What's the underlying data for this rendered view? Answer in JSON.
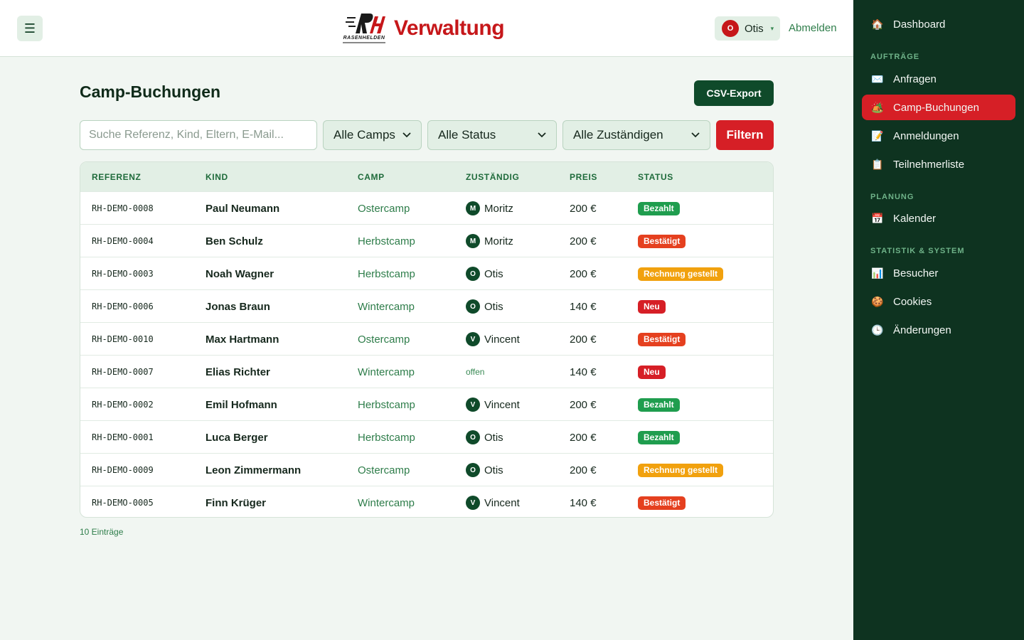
{
  "header": {
    "menu_icon": "☰",
    "logo_letters": "RH",
    "logo_text": "RASENHELDEN",
    "title": "Verwaltung",
    "user_initial": "O",
    "user_name": "Otis",
    "caret": "▾",
    "logout": "Abmelden"
  },
  "main": {
    "title": "Camp-Buchungen",
    "csv_button": "CSV-Export",
    "search_placeholder": "Suche Referenz, Kind, Eltern, E-Mail...",
    "filter_camp": "Alle Camps",
    "filter_status": "Alle Status",
    "filter_owner": "Alle Zuständigen",
    "filter_button": "Filtern",
    "count": "10 Einträge"
  },
  "table": {
    "headers": [
      "REFERENZ",
      "KIND",
      "CAMP",
      "ZUSTÄNDIG",
      "PREIS",
      "STATUS"
    ],
    "rows": [
      {
        "ref": "RH-DEMO-0008",
        "kind": "Paul Neumann",
        "camp": "Ostercamp",
        "initial": "M",
        "owner": "Moritz",
        "price": "200 €",
        "status": "Bezahlt",
        "status_type": "paid"
      },
      {
        "ref": "RH-DEMO-0004",
        "kind": "Ben Schulz",
        "camp": "Herbstcamp",
        "initial": "M",
        "owner": "Moritz",
        "price": "200 €",
        "status": "Bestätigt",
        "status_type": "conf"
      },
      {
        "ref": "RH-DEMO-0003",
        "kind": "Noah Wagner",
        "camp": "Herbstcamp",
        "initial": "O",
        "owner": "Otis",
        "price": "200 €",
        "status": "Rechnung gestellt",
        "status_type": "inv"
      },
      {
        "ref": "RH-DEMO-0006",
        "kind": "Jonas Braun",
        "camp": "Wintercamp",
        "initial": "O",
        "owner": "Otis",
        "price": "140 €",
        "status": "Neu",
        "status_type": "new"
      },
      {
        "ref": "RH-DEMO-0010",
        "kind": "Max Hartmann",
        "camp": "Ostercamp",
        "initial": "V",
        "owner": "Vincent",
        "price": "200 €",
        "status": "Bestätigt",
        "status_type": "conf"
      },
      {
        "ref": "RH-DEMO-0007",
        "kind": "Elias Richter",
        "camp": "Wintercamp",
        "initial": "",
        "owner": "offen",
        "price": "140 €",
        "status": "Neu",
        "status_type": "new"
      },
      {
        "ref": "RH-DEMO-0002",
        "kind": "Emil Hofmann",
        "camp": "Herbstcamp",
        "initial": "V",
        "owner": "Vincent",
        "price": "200 €",
        "status": "Bezahlt",
        "status_type": "paid"
      },
      {
        "ref": "RH-DEMO-0001",
        "kind": "Luca Berger",
        "camp": "Herbstcamp",
        "initial": "O",
        "owner": "Otis",
        "price": "200 €",
        "status": "Bezahlt",
        "status_type": "paid"
      },
      {
        "ref": "RH-DEMO-0009",
        "kind": "Leon Zimmermann",
        "camp": "Ostercamp",
        "initial": "O",
        "owner": "Otis",
        "price": "200 €",
        "status": "Rechnung gestellt",
        "status_type": "inv"
      },
      {
        "ref": "RH-DEMO-0005",
        "kind": "Finn Krüger",
        "camp": "Wintercamp",
        "initial": "V",
        "owner": "Vincent",
        "price": "140 €",
        "status": "Bestätigt",
        "status_type": "conf"
      }
    ]
  },
  "sidebar": {
    "dashboard": {
      "label": "Dashboard",
      "icon": "🏠"
    },
    "section_orders": "AUFTRÄGE",
    "anfragen": {
      "label": "Anfragen",
      "icon": "✉️"
    },
    "camp_buchungen": {
      "label": "Camp-Buchungen",
      "icon": "🏕️"
    },
    "anmeldungen": {
      "label": "Anmeldungen",
      "icon": "📝"
    },
    "teilnehmerliste": {
      "label": "Teilnehmerliste",
      "icon": "📋"
    },
    "section_planning": "PLANUNG",
    "kalender": {
      "label": "Kalender",
      "icon": "📅"
    },
    "section_stats": "STATISTIK & SYSTEM",
    "besucher": {
      "label": "Besucher",
      "icon": "📊"
    },
    "cookies": {
      "label": "Cookies",
      "icon": "🍪"
    },
    "aenderungen": {
      "label": "Änderungen",
      "icon": "🕒"
    }
  },
  "colors": {
    "brand_red": "#d61f26",
    "brand_green": "#0e3320",
    "paid": "#1f9d4e",
    "confirmed": "#e5401f",
    "invoiced": "#f1a10e",
    "new": "#d61f26"
  }
}
